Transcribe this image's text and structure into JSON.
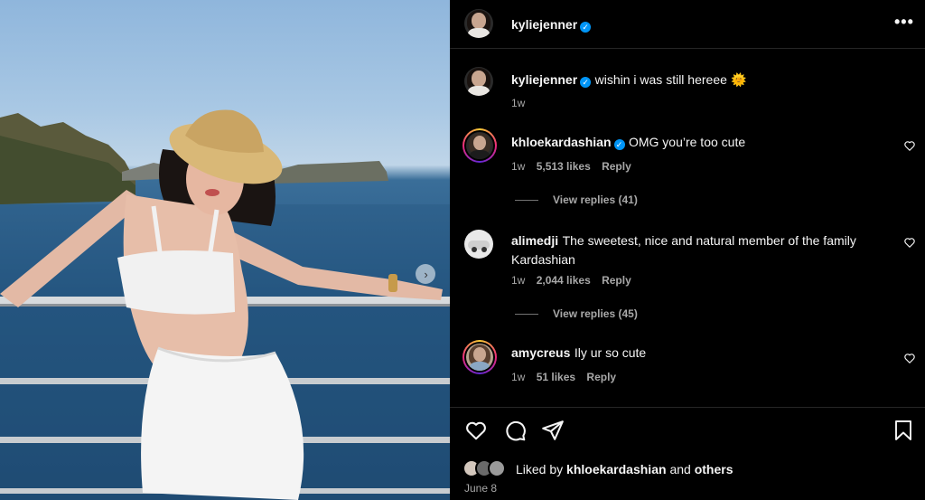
{
  "post": {
    "author": "kyliejenner",
    "caption_text": "wishin i was still hereee",
    "caption_emoji": "🌞",
    "caption_time": "1w",
    "likes_prefix": "Liked by",
    "likes_user": "khloekardashian",
    "likes_and": "and",
    "likes_others": "others",
    "date": "June 8"
  },
  "comments": [
    {
      "user": "khloekardashian",
      "verified": true,
      "text": "OMG you’re too cute",
      "time": "1w",
      "likes": "5,513 likes",
      "reply": "Reply",
      "view_replies": "View replies (41)"
    },
    {
      "user": "alimedji",
      "verified": false,
      "text": "The sweetest, nice and natural member of the family",
      "text_line2": "Kardashian",
      "time": "1w",
      "likes": "2,044 likes",
      "reply": "Reply",
      "view_replies": "View replies (45)"
    },
    {
      "user": "amycreus",
      "verified": false,
      "text": "Ily ur so cute",
      "time": "1w",
      "likes": "51 likes",
      "reply": "Reply"
    }
  ],
  "icons": {
    "more": "more-options-icon",
    "verified": "verified-badge-icon",
    "like": "heart-icon",
    "comment": "comment-icon",
    "share": "share-icon",
    "save": "bookmark-icon",
    "next": "chevron-right-icon"
  },
  "glyphs": {
    "more": "•••",
    "verified": "✓",
    "next": "›"
  },
  "colors": {
    "background": "#000000",
    "verified": "#0095f6",
    "muted": "#a8a8a8"
  }
}
